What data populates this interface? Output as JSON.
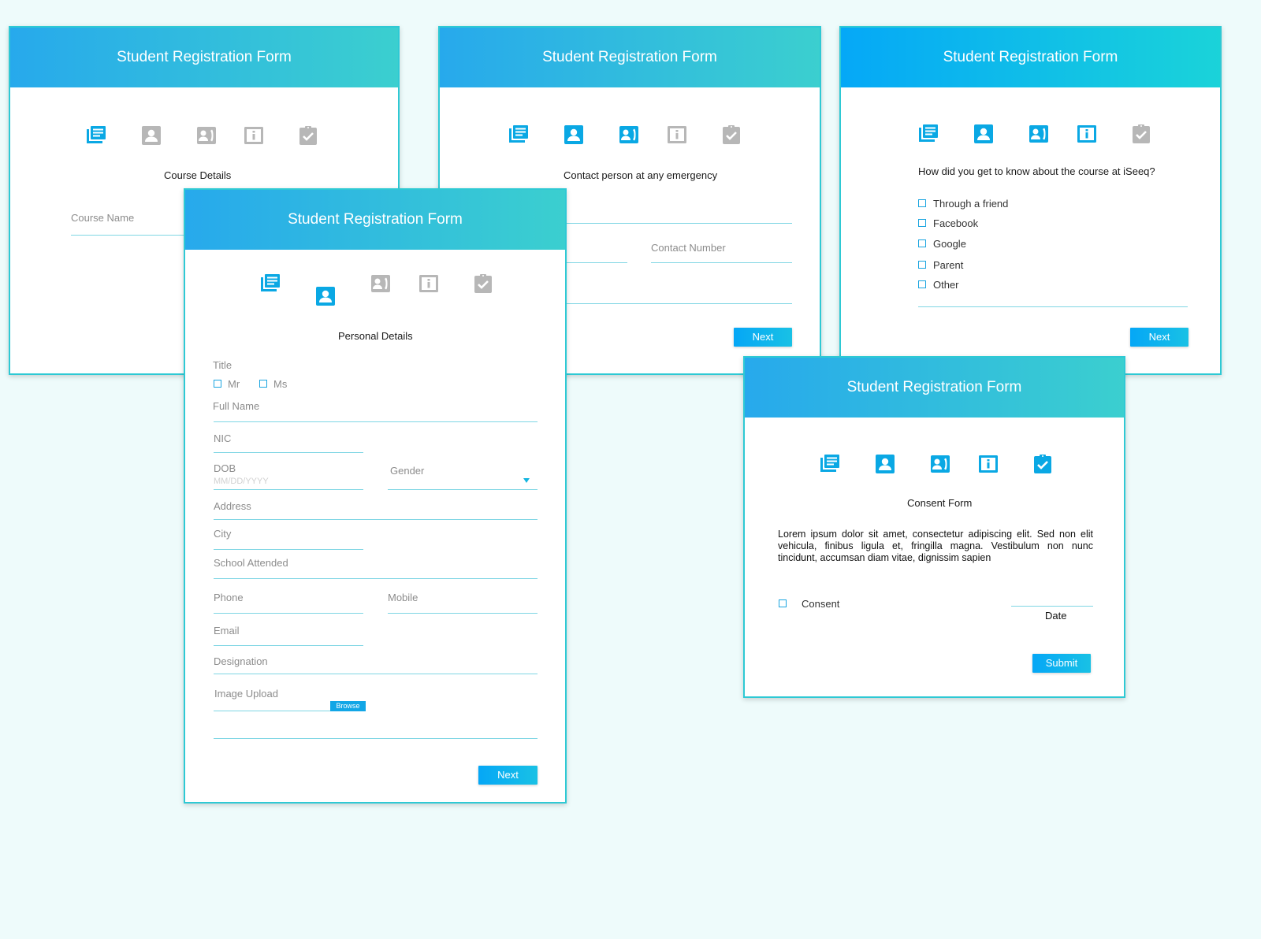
{
  "form_title": "Student Registration Form",
  "card1": {
    "step_title": "Course Details",
    "course_name_label": "Course Name"
  },
  "card2": {
    "step_title": "Contact person at any emergency",
    "contact_number_label": "Contact Number",
    "next_label": "Next"
  },
  "card3": {
    "question": "How did you get to know about the course at iSeeq?",
    "options": [
      "Through a friend",
      "Facebook",
      "Google",
      "Parent",
      "Other"
    ],
    "next_label": "Next"
  },
  "card4": {
    "step_title": "Personal Details",
    "title_label": "Title",
    "title_options": [
      "Mr",
      "Ms"
    ],
    "full_name_label": "Full Name",
    "nic_label": "NIC",
    "dob_label": "DOB",
    "dob_placeholder": "MM/DD/YYYY",
    "gender_label": "Gender",
    "address_label": "Address",
    "city_label": "City",
    "school_label": "School Attended",
    "phone_label": "Phone",
    "mobile_label": "Mobile",
    "email_label": "Email",
    "designation_label": "Designation",
    "image_upload_label": "Image Upload",
    "browse_label": "Browse",
    "next_label": "Next"
  },
  "card5": {
    "step_title": "Consent Form",
    "lorem": "Lorem ipsum dolor sit amet, consectetur adipiscing elit. Sed non elit vehicula, finibus ligula et, fringilla magna. Vestibulum non nunc tincidunt, accumsan diam vitae, dignissim sapien",
    "consent_label": "Consent",
    "date_label": "Date",
    "submit_label": "Submit"
  },
  "step_icons": [
    "course-details-icon",
    "personal-details-icon",
    "contact-person-icon",
    "info-icon",
    "consent-check-icon"
  ],
  "colors": {
    "accent": "#0aa8e4",
    "inactive": "#b7b7b7",
    "border": "#2ec9d4"
  }
}
